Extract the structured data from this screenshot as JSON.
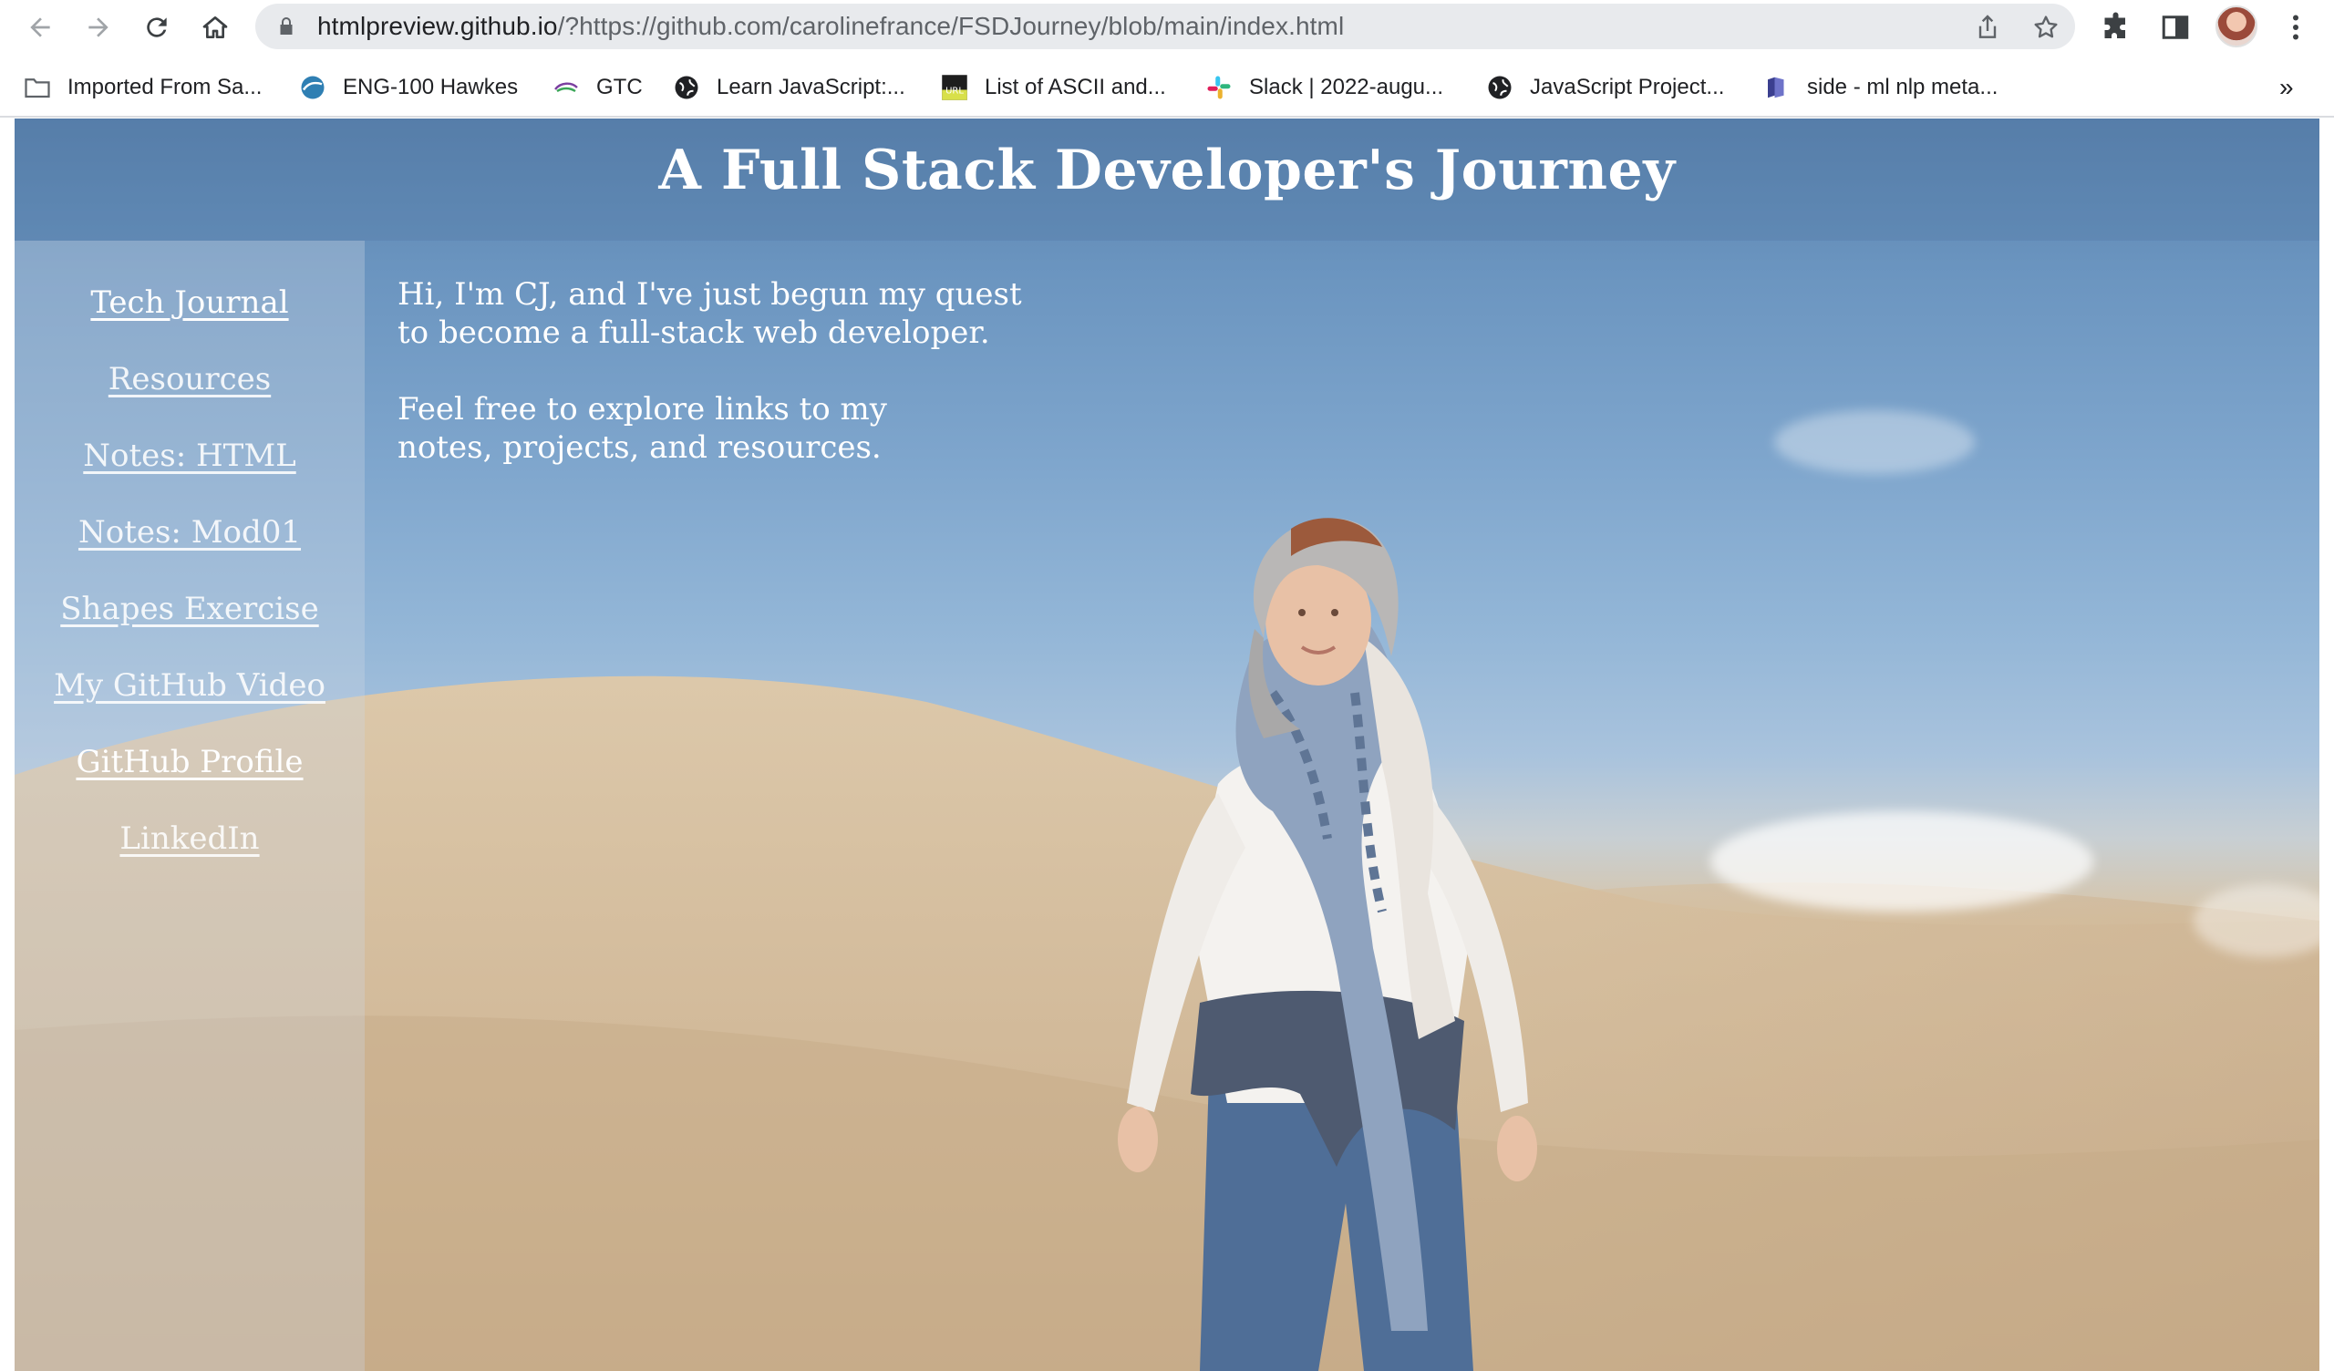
{
  "browser": {
    "url_host": "htmlpreview.github.io",
    "url_rest": "/?https://github.com/carolinefrance/FSDJourney/blob/main/index.html",
    "bookmarks": [
      {
        "label": "Imported From Sa...",
        "icon": "folder-icon"
      },
      {
        "label": "ENG-100 Hawkes",
        "icon": "globe-blue-icon"
      },
      {
        "label": "GTC",
        "icon": "gtc-logo-icon"
      },
      {
        "label": "Learn JavaScript:...",
        "icon": "globe-icon"
      },
      {
        "label": "List of ASCII and...",
        "icon": "url-icon"
      },
      {
        "label": "Slack | 2022-augu...",
        "icon": "slack-icon"
      },
      {
        "label": "JavaScript Project...",
        "icon": "globe-icon"
      },
      {
        "label": "side - ml nlp meta...",
        "icon": "notion-icon"
      }
    ],
    "bookmarks_more": "»"
  },
  "page": {
    "title": "A Full Stack Developer's Journey",
    "nav": [
      {
        "label": "Tech Journal",
        "active": true
      },
      {
        "label": "Resources",
        "active": false
      },
      {
        "label": "Notes: HTML",
        "active": false
      },
      {
        "label": "Notes: Mod01",
        "active": false
      },
      {
        "label": "Shapes Exercise",
        "active": false
      },
      {
        "label": "My GitHub Video",
        "active": false
      },
      {
        "label": "GitHub Profile",
        "active": true
      },
      {
        "label": "LinkedIn",
        "active": false
      }
    ],
    "intro": [
      [
        "Hi, I'm CJ, and I've just begun my quest",
        "to become a full-stack web developer."
      ],
      [
        "Feel free to explore links to my",
        "notes, projects, and resources."
      ]
    ]
  },
  "colors": {
    "sky_top": "#587fab",
    "sand": "#d5bd9c",
    "link": "#ffffff",
    "sidebar_overlay": "rgba(205,215,228,0.32)"
  }
}
